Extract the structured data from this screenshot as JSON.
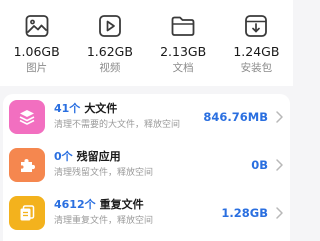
{
  "categories": [
    {
      "size": "1.06GB",
      "label": "图片",
      "icon": "image-icon"
    },
    {
      "size": "1.62GB",
      "label": "视频",
      "icon": "video-icon"
    },
    {
      "size": "2.13GB",
      "label": "文档",
      "icon": "folder-icon"
    },
    {
      "size": "1.24GB",
      "label": "安装包",
      "icon": "package-icon"
    }
  ],
  "rows": [
    {
      "count": "41个",
      "name": "大文件",
      "subtitle": "清理不需要的大文件，释放空间",
      "value": "846.76MB",
      "icon": "layers-icon",
      "color": "#f26fc0"
    },
    {
      "count": "0个",
      "name": "残留应用",
      "subtitle": "清理残留文件，释放空间",
      "value": "0B",
      "icon": "puzzle-icon",
      "color": "#f5874f"
    },
    {
      "count": "4612个",
      "name": "重复文件",
      "subtitle": "清理重复文件，释放空间",
      "value": "1.28GB",
      "icon": "duplicate-icon",
      "color": "#f3b21d"
    }
  ],
  "colors": {
    "accent": "#2a6fe0",
    "icon_stroke": "#3a3a3a"
  }
}
